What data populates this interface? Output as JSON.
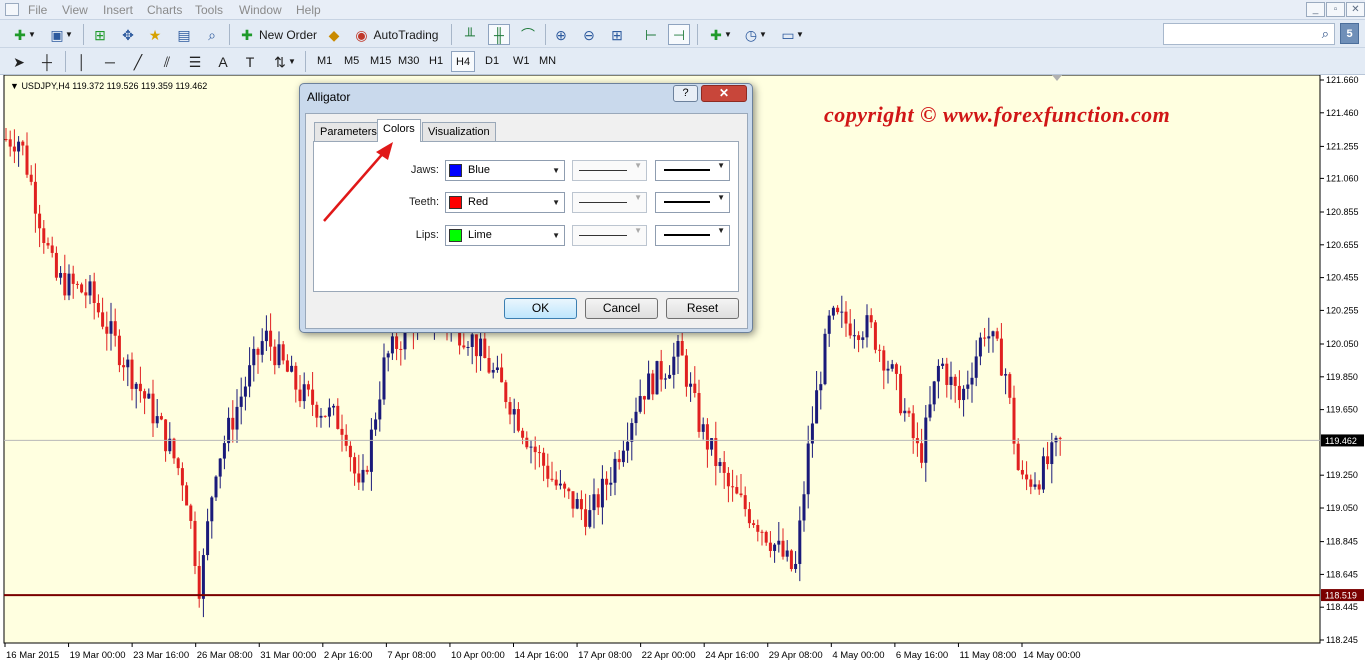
{
  "menu": {
    "items": [
      "File",
      "View",
      "Insert",
      "Charts",
      "Tools",
      "Window",
      "Help"
    ]
  },
  "window_controls": {
    "minimize": "_",
    "restore": "▫",
    "close": "✕"
  },
  "toolbar": {
    "new_order_label": "New Order",
    "autotrading_label": "AutoTrading",
    "timeframes": [
      "M1",
      "M5",
      "M15",
      "M30",
      "H1",
      "H4",
      "D1",
      "W1",
      "MN"
    ],
    "active_timeframe": "H4",
    "notification_badge": "5",
    "search_placeholder": ""
  },
  "chart": {
    "symbol_info": "USDJPY,H4  119.372 119.526 119.359 119.462",
    "watermark": "copyright ©  www.forexfunction.com",
    "background": "#ffffe0",
    "bull_color": "#1a1a7a",
    "bear_color": "#e02020",
    "current_price_label": "119.462",
    "hline_price_label": "118.519",
    "price_axis": [
      "121.660",
      "121.460",
      "121.255",
      "121.060",
      "120.855",
      "120.655",
      "120.455",
      "120.255",
      "120.050",
      "119.850",
      "119.650",
      "119.462",
      "119.250",
      "119.050",
      "118.845",
      "118.645",
      "118.519",
      "118.445",
      "118.245"
    ],
    "time_axis": [
      "16 Mar 2015",
      "19 Mar 00:00",
      "23 Mar 16:00",
      "26 Mar 08:00",
      "31 Mar 00:00",
      "2 Apr 16:00",
      "7 Apr 08:00",
      "10 Apr 00:00",
      "14 Apr 16:00",
      "17 Apr 08:00",
      "22 Apr 00:00",
      "24 Apr 16:00",
      "29 Apr 08:00",
      "4 May 00:00",
      "6 May 16:00",
      "11 May 08:00",
      "14 May 00:00"
    ]
  },
  "dialog": {
    "title": "Alligator",
    "help": "?",
    "close": "✕",
    "tabs": [
      "Parameters",
      "Colors",
      "Visualization"
    ],
    "active_tab": "Colors",
    "rows": [
      {
        "label": "Jaws:",
        "color_name": "Blue",
        "color": "#0000ff"
      },
      {
        "label": "Teeth:",
        "color_name": "Red",
        "color": "#ff0000"
      },
      {
        "label": "Lips:",
        "color_name": "Lime",
        "color": "#00ff00"
      }
    ],
    "buttons": {
      "ok": "OK",
      "cancel": "Cancel",
      "reset": "Reset"
    }
  }
}
